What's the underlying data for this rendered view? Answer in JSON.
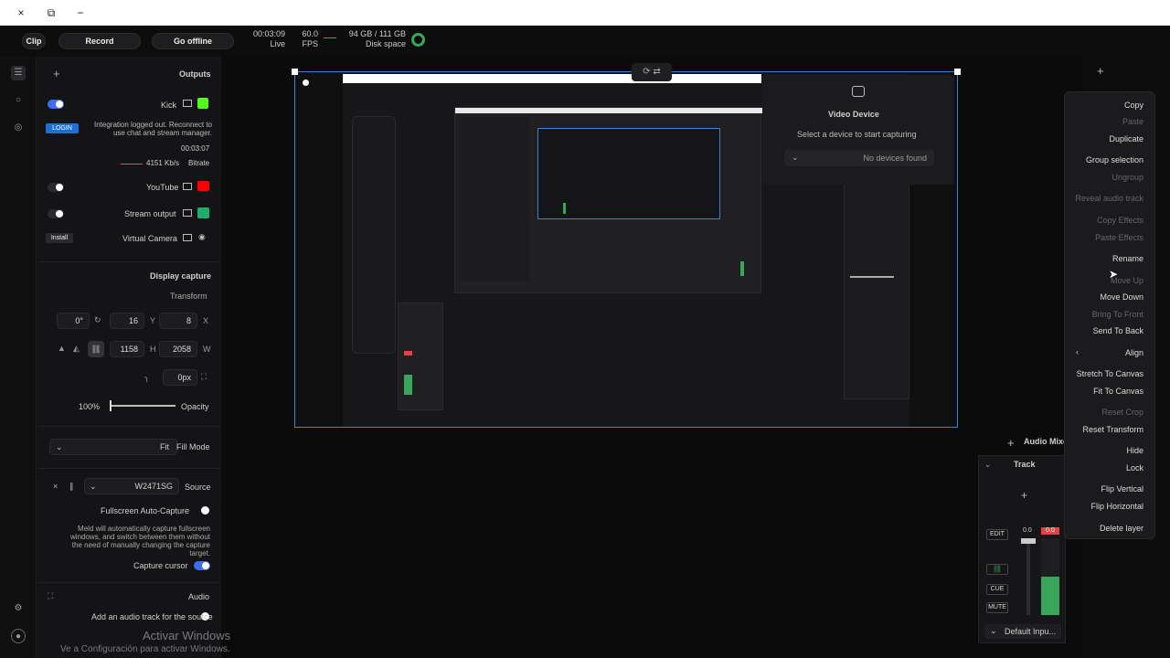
{
  "titlebar": {
    "close_icon": "×",
    "restore_icon": "⧉",
    "minimize_icon": "−"
  },
  "topbar": {
    "clip_label": "Clip",
    "record_label": "Record",
    "go_offline_label": "Go offline",
    "live_time": "00:03:09",
    "live_label": "Live",
    "fps_value": "60.0",
    "fps_label": "FPS",
    "disk_value": "94 GB / 111 GB",
    "disk_label": "Disk space"
  },
  "outputs": {
    "title": "Outputs",
    "kick": {
      "name": "Kick",
      "warning": "Integration logged out. Reconnect to use chat and stream manager.",
      "login_label": "LOGIN",
      "time": "00:03:07",
      "bitrate_label": "Bitrate",
      "bitrate_value": "4151 Kb/s"
    },
    "youtube": {
      "name": "YouTube"
    },
    "stream_output": {
      "name": "Stream output"
    },
    "virtual_camera": {
      "name": "Virtual Camera",
      "install_label": "Install"
    }
  },
  "display_capture": {
    "title": "Display capture",
    "transform_label": "Transform",
    "x_label": "X",
    "x_value": "8",
    "y_label": "Y",
    "y_value": "16",
    "rotation_value": "0°",
    "w_label": "W",
    "w_value": "2058",
    "h_label": "H",
    "h_value": "1158",
    "radius_value": "0px",
    "opacity_label": "Opacity",
    "opacity_value": "100%",
    "fill_mode_label": "Fill Mode",
    "fill_mode_value": "Fit",
    "source_label": "Source",
    "source_value": "W2471SG",
    "fullscreen_label": "Fullscreen Auto-Capture",
    "fullscreen_desc": "Meld will automatically capture fullscreen windows, and switch between them without the need of manually changing the capture target.",
    "capture_cursor_label": "Capture cursor",
    "audio_label": "Audio",
    "add_audio_label": "Add an audio track for the source"
  },
  "video_device": {
    "title": "Video Device",
    "subtitle": "Select a device to start capturing",
    "dropdown_value": "No devices found"
  },
  "audio_mixer": {
    "title": "Audio Mixer",
    "track_label": "Track",
    "edit_label": "EDIT",
    "cue_label": "CUE",
    "mute_label": "MUTE",
    "level_value": "0.0",
    "peak_value": "0.0",
    "input_label": "Default Inpu..."
  },
  "context_menu": {
    "items": [
      {
        "label": "Copy",
        "enabled": true
      },
      {
        "label": "Paste",
        "enabled": false
      },
      {
        "label": "Duplicate",
        "enabled": true
      },
      {
        "label": "Group selection",
        "enabled": true
      },
      {
        "label": "Ungroup",
        "enabled": false
      },
      {
        "label": "Reveal audio track",
        "enabled": false
      },
      {
        "label": "Copy Effects",
        "enabled": false
      },
      {
        "label": "Paste Effects",
        "enabled": false
      },
      {
        "label": "Rename",
        "enabled": true
      },
      {
        "label": "Move Up",
        "enabled": false
      },
      {
        "label": "Move Down",
        "enabled": true
      },
      {
        "label": "Bring To Front",
        "enabled": false
      },
      {
        "label": "Send To Back",
        "enabled": true
      },
      {
        "label": "Align",
        "enabled": true
      },
      {
        "label": "Stretch To Canvas",
        "enabled": true
      },
      {
        "label": "Fit To Canvas",
        "enabled": true
      },
      {
        "label": "Reset Crop",
        "enabled": false
      },
      {
        "label": "Reset Transform",
        "enabled": true
      },
      {
        "label": "Hide",
        "enabled": true
      },
      {
        "label": "Lock",
        "enabled": true
      },
      {
        "label": "Flip Vertical",
        "enabled": true
      },
      {
        "label": "Flip Horizontal",
        "enabled": true
      },
      {
        "label": "Delete layer",
        "enabled": true
      }
    ]
  },
  "watermark": {
    "line1": "Activar Windows",
    "line2": "Ve a Configuración para activar Windows."
  },
  "colors": {
    "accent": "#3f6df2",
    "kick_green": "#53fc18",
    "youtube_red": "#ff0000",
    "live_green": "#3aa55d",
    "selection_blue": "#3b82d6"
  }
}
